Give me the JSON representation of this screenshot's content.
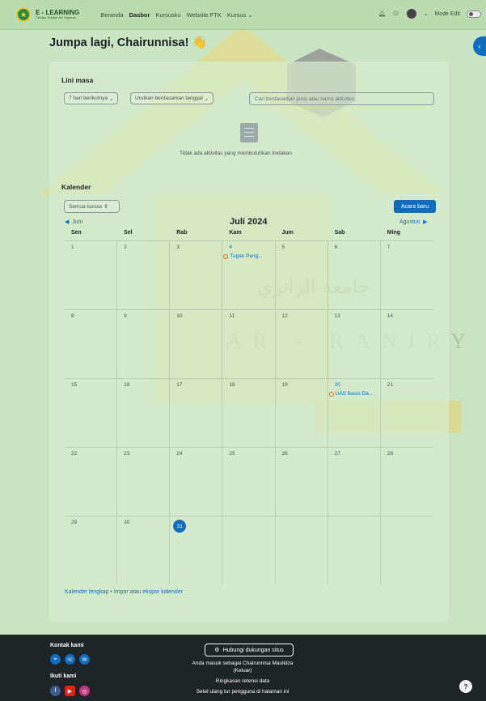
{
  "brand": {
    "title": "E - LEARNING",
    "subtitle": "Fakultas Tarbiyah dan Keguruan"
  },
  "watermark": {
    "arabic": "جامعة الرانري",
    "latin": "AR - RANIRY"
  },
  "nav": {
    "items": [
      "Beranda",
      "Dasbor",
      "Kursusku",
      "Website FTK",
      "Kursus"
    ],
    "active": "Dasbor",
    "edit_mode": "Mode Edit"
  },
  "greeting": "Jumpa lagi, Chairunnisa! 👋",
  "timeline": {
    "title": "Lini masa",
    "filter": "7 hari berikutnya",
    "sort": "Urutkan berdasarkan tanggal",
    "search_placeholder": "Cari berdasarkan jenis atau nama aktivitas",
    "empty": "Tidak ada aktivitas yang membutuhkan tindakan"
  },
  "calendar": {
    "title": "Kalender",
    "course_filter": "Semua kursus",
    "new_event": "Acara baru",
    "prev": "Juni",
    "month": "Juli 2024",
    "next": "Agustus",
    "days": [
      "Sen",
      "Sel",
      "Rab",
      "Kam",
      "Jum",
      "Sab",
      "Ming"
    ],
    "weeks": [
      [
        {
          "d": "1"
        },
        {
          "d": "2"
        },
        {
          "d": "3"
        },
        {
          "d": "4",
          "link": true,
          "event": "Tugas Peng..."
        },
        {
          "d": "5"
        },
        {
          "d": "6"
        },
        {
          "d": "7"
        }
      ],
      [
        {
          "d": "8"
        },
        {
          "d": "9"
        },
        {
          "d": "10"
        },
        {
          "d": "11"
        },
        {
          "d": "12"
        },
        {
          "d": "13"
        },
        {
          "d": "14"
        }
      ],
      [
        {
          "d": "15"
        },
        {
          "d": "16"
        },
        {
          "d": "17"
        },
        {
          "d": "18"
        },
        {
          "d": "19"
        },
        {
          "d": "20",
          "link": true,
          "event": "UAS Basis Da..."
        },
        {
          "d": "21"
        }
      ],
      [
        {
          "d": "22"
        },
        {
          "d": "23"
        },
        {
          "d": "24"
        },
        {
          "d": "25"
        },
        {
          "d": "26"
        },
        {
          "d": "27"
        },
        {
          "d": "28"
        }
      ],
      [
        {
          "d": "29"
        },
        {
          "d": "30"
        },
        {
          "d": "31",
          "today": true
        },
        {
          "d": ""
        },
        {
          "d": ""
        },
        {
          "d": ""
        },
        {
          "d": ""
        }
      ]
    ],
    "links": "Kalender lengkap • Impor atau ekspor kalender"
  },
  "footer": {
    "contact": "Kontak kami",
    "follow": "Ikuti kami",
    "support": "Hubungi dukungan situs",
    "logged_in": "Anda masuk sebagai Chairunnisa Maulidza",
    "logout": "(Keluar)",
    "retention": "Ringkasan retensi data",
    "reset_tour": "Setel ulang tur pengguna di halaman ini",
    "help": "?"
  },
  "colors": {
    "accent": "#0f6cbf",
    "event": "#e5731a",
    "footer": "#1f2427"
  }
}
